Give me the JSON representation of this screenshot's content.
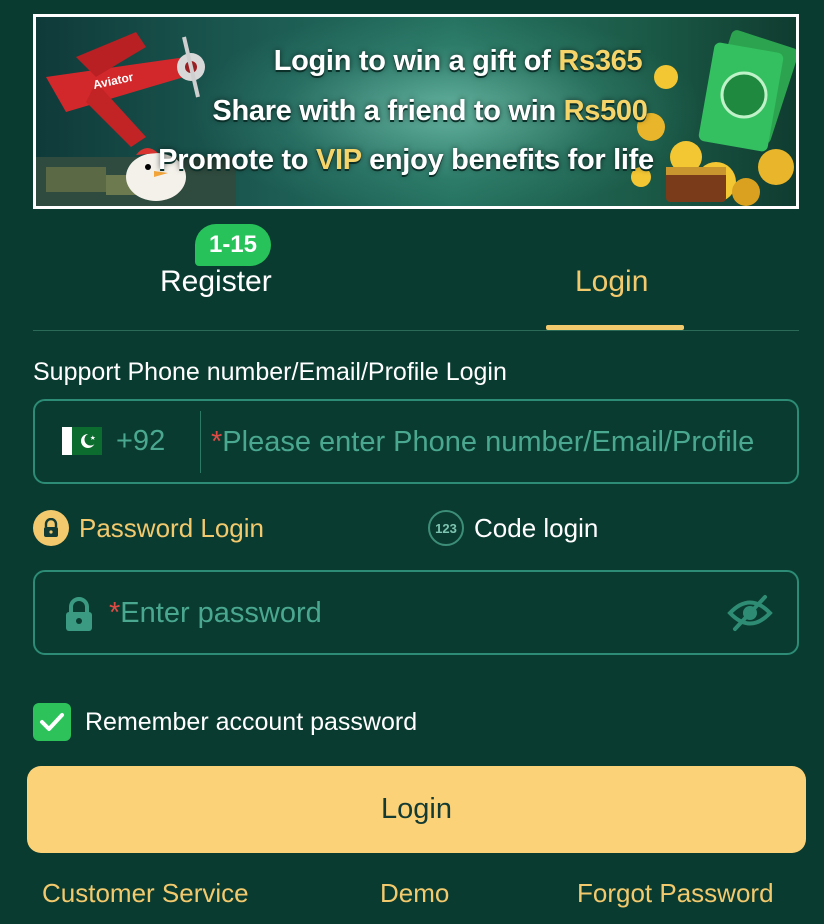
{
  "banner": {
    "line1_pre": "Login to win a gift of ",
    "line1_hl": "Rs365",
    "line2_pre": "Share with a friend to win ",
    "line2_hl": "Rs500",
    "line3_pre": "Promote to ",
    "line3_hl": "VIP",
    "line3_post": " enjoy benefits for life"
  },
  "tabs": {
    "register_label": "Register",
    "register_badge": "1-15",
    "login_label": "Login",
    "active": "Login"
  },
  "form": {
    "support_label": "Support Phone number/Email/Profile Login",
    "country_code": "+92",
    "phone_placeholder": "Please enter Phone number/Email/Profile",
    "password_mode_label": "Password Login",
    "code_mode_label": "Code login",
    "code_mode_icon_text": "123",
    "password_placeholder": "Enter password",
    "remember_label": "Remember account password",
    "remember_checked": true,
    "login_button": "Login"
  },
  "footer": {
    "customer_service": "Customer Service",
    "demo": "Demo",
    "forgot_password": "Forgot Password"
  },
  "colors": {
    "background": "#0a3b30",
    "accent_gold": "#f2c96d",
    "button": "#fcd278",
    "badge_green": "#27c25a",
    "input_border": "#2c8c75",
    "placeholder": "#4aa890",
    "required": "#e04a45"
  },
  "icons": {
    "flag": "pakistan-flag-icon",
    "lock": "lock-icon",
    "eye": "eye-slash-icon",
    "check": "check-icon"
  }
}
